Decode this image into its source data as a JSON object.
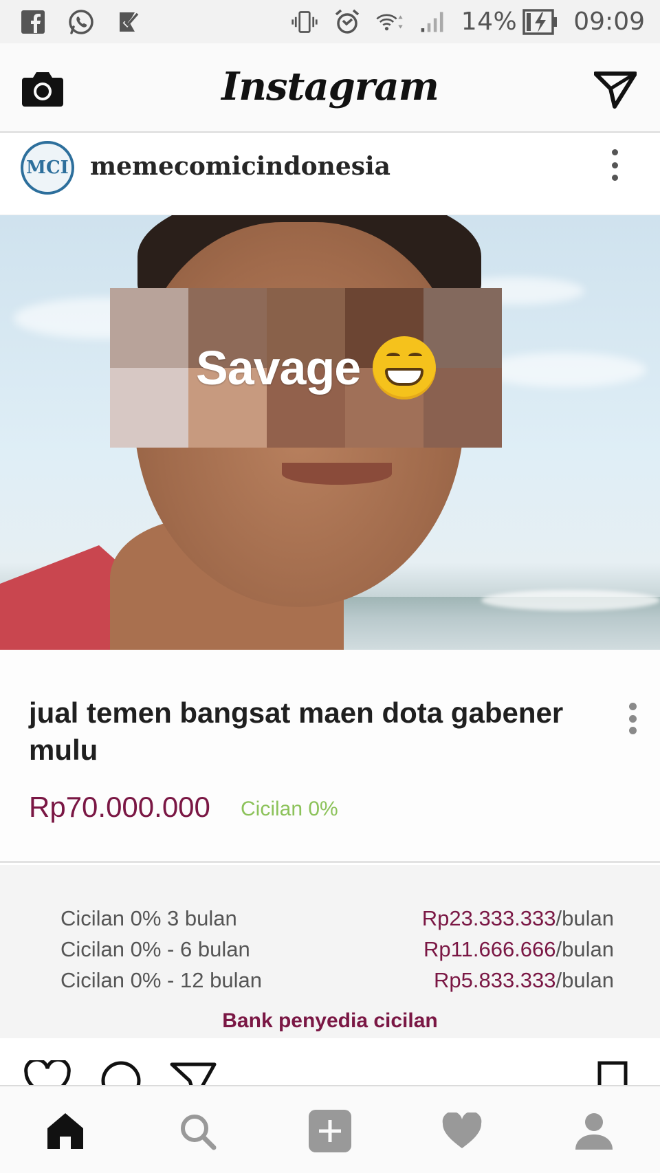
{
  "status_bar": {
    "battery_percent": "14%",
    "time": "09:09",
    "left_icons": [
      "facebook-icon",
      "whatsapp-icon",
      "tasks-icon"
    ],
    "right_icons": [
      "vibrate-icon",
      "alarm-icon",
      "wifi-icon",
      "signal-icon",
      "battery-charging-icon"
    ]
  },
  "app_bar": {
    "title": "Instagram",
    "left_icon": "camera-icon",
    "right_icon": "direct-send-icon"
  },
  "post": {
    "username": "memecomicindonesia",
    "avatar_text": "MCI",
    "image_overlay_text": "Savage",
    "overlay_emoji": "grinning-face-icon",
    "actions": [
      "heart-icon",
      "comment-icon",
      "share-icon",
      "bookmark-icon"
    ]
  },
  "product": {
    "title": "jual temen bangsat maen dota gabener mulu",
    "price": "Rp70.000.000",
    "badge": "Cicilan 0%"
  },
  "installments": {
    "rows": [
      {
        "label": "Cicilan 0%  3 bulan",
        "amount": "Rp23.333.333",
        "per": "/bulan"
      },
      {
        "label": "Cicilan 0% - 6 bulan",
        "amount": "Rp11.666.666",
        "per": "/bulan"
      },
      {
        "label": "Cicilan 0% - 12 bulan",
        "amount": "Rp5.833.333",
        "per": "/bulan"
      }
    ],
    "bank_link": "Bank penyedia cicilan"
  },
  "bottom_nav": {
    "items": [
      "home-icon",
      "search-icon",
      "add-post-icon",
      "activity-heart-icon",
      "profile-icon"
    ]
  },
  "colors": {
    "price": "#7a1744",
    "badge": "#8cc25a",
    "brand_blue": "#2d6f9c"
  }
}
